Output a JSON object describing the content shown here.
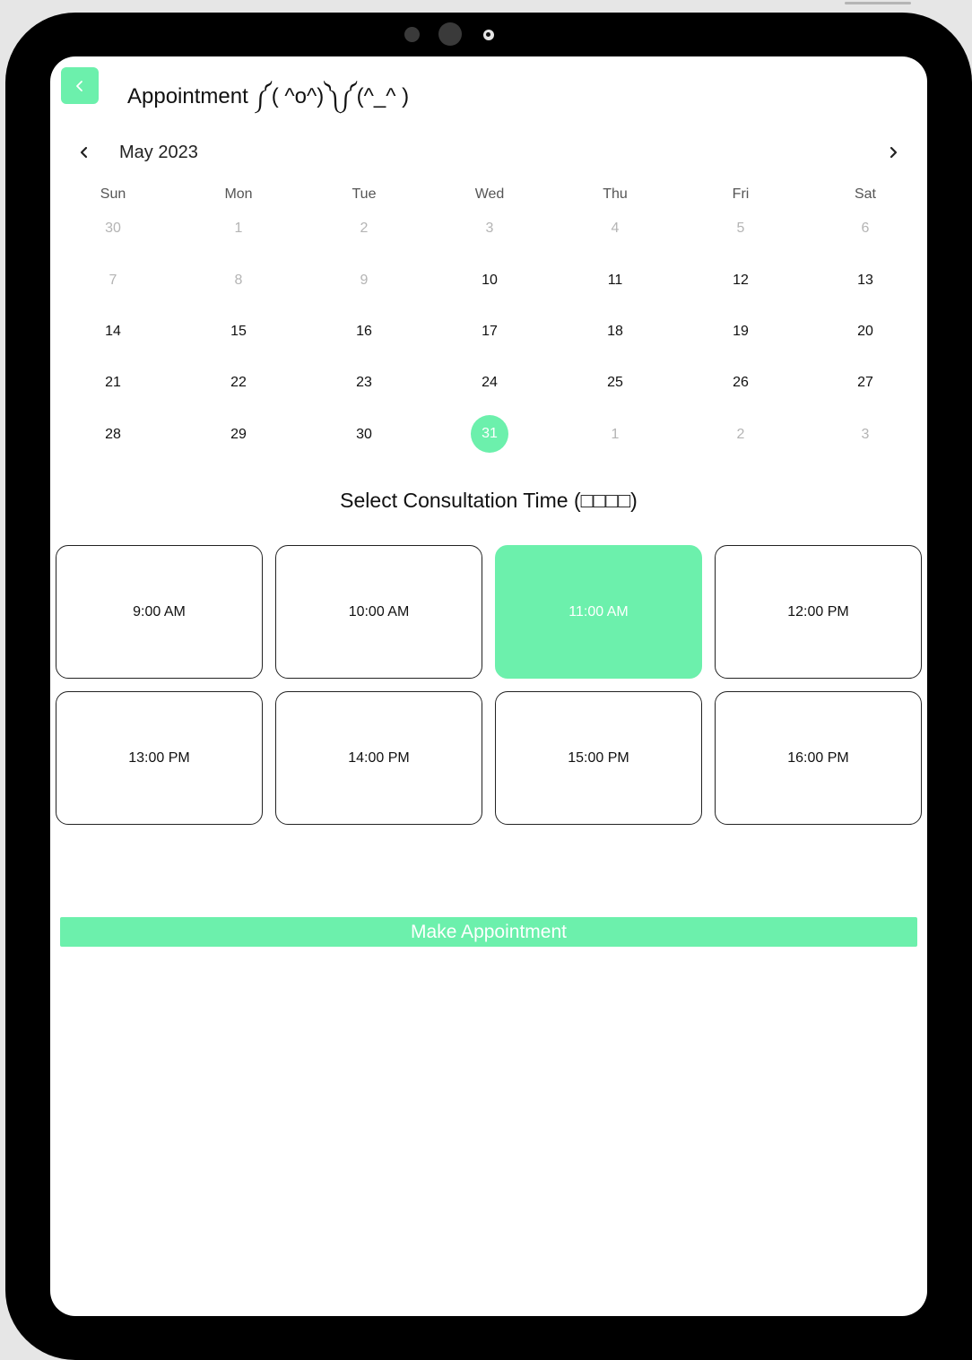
{
  "header": {
    "title": "Appointment ༼( ^o^)༽༼(^_^ )"
  },
  "calendar": {
    "month_label": "May 2023",
    "weekdays": [
      "Sun",
      "Mon",
      "Tue",
      "Wed",
      "Thu",
      "Fri",
      "Sat"
    ],
    "weeks": [
      [
        {
          "d": "30",
          "muted": true
        },
        {
          "d": "1",
          "muted": true
        },
        {
          "d": "2",
          "muted": true
        },
        {
          "d": "3",
          "muted": true
        },
        {
          "d": "4",
          "muted": true
        },
        {
          "d": "5",
          "muted": true
        },
        {
          "d": "6",
          "muted": true
        }
      ],
      [
        {
          "d": "7",
          "muted": true
        },
        {
          "d": "8",
          "muted": true
        },
        {
          "d": "9",
          "muted": true
        },
        {
          "d": "10"
        },
        {
          "d": "11"
        },
        {
          "d": "12"
        },
        {
          "d": "13"
        }
      ],
      [
        {
          "d": "14"
        },
        {
          "d": "15"
        },
        {
          "d": "16"
        },
        {
          "d": "17"
        },
        {
          "d": "18"
        },
        {
          "d": "19"
        },
        {
          "d": "20"
        }
      ],
      [
        {
          "d": "21"
        },
        {
          "d": "22"
        },
        {
          "d": "23"
        },
        {
          "d": "24"
        },
        {
          "d": "25"
        },
        {
          "d": "26"
        },
        {
          "d": "27"
        }
      ],
      [
        {
          "d": "28"
        },
        {
          "d": "29"
        },
        {
          "d": "30"
        },
        {
          "d": "31",
          "selected": true
        },
        {
          "d": "1",
          "muted": true
        },
        {
          "d": "2",
          "muted": true
        },
        {
          "d": "3",
          "muted": true
        }
      ]
    ]
  },
  "consultation": {
    "title": "Select Consultation Time (□□□□)",
    "slots": [
      {
        "label": "9:00 AM"
      },
      {
        "label": "10:00 AM"
      },
      {
        "label": "11:00 AM",
        "selected": true
      },
      {
        "label": "12:00 PM"
      },
      {
        "label": "13:00 PM"
      },
      {
        "label": "14:00 PM"
      },
      {
        "label": "15:00 PM"
      },
      {
        "label": "16:00 PM"
      }
    ]
  },
  "actions": {
    "make_appointment_label": "Make Appointment"
  },
  "colors": {
    "accent": "#6cf0ac",
    "device_frame": "#000000",
    "muted_day": "#b4b4b4"
  },
  "icons": {
    "back": "chevron-left-icon",
    "prev_month": "chevron-left-icon",
    "next_month": "chevron-right-icon"
  }
}
